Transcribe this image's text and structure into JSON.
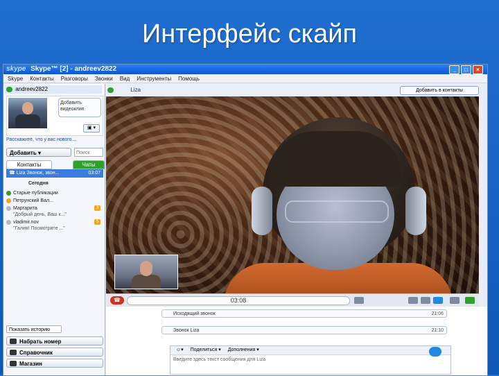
{
  "slide": {
    "title": "Интерфейс скайп"
  },
  "window": {
    "logo": "skype",
    "title": "Skype™ [2] - andreev2822",
    "min": "_",
    "max": "□",
    "close": "×"
  },
  "menu": [
    "Skype",
    "Контакты",
    "Разговоры",
    "Звонки",
    "Вид",
    "Инструменты",
    "Помощь"
  ],
  "left": {
    "username": "andreev2822",
    "profile_bubble": "Добавить видеоклип",
    "video_btn": "▣ ▾",
    "mood": "Расскажите, что у вас нового...",
    "add_button": "Добавить ▾",
    "search_placeholder": "Поиск",
    "tab_contacts": "Контакты",
    "tab_other": "Чаты",
    "selected_contact": {
      "name": "Liza",
      "sub": "Звонок, звон...",
      "time": "03:07"
    },
    "today_label": "Сегодня",
    "recent": [
      {
        "name": "Старые публикации",
        "sub": "",
        "count": "",
        "color": "#2ea12b"
      },
      {
        "name": "Петрунский Вал...",
        "sub": "",
        "count": "",
        "color": "#f2a51d"
      },
      {
        "name": "Маргарита",
        "sub": "\"Добрый день, Ваш к...\"",
        "count": "3",
        "color": "#b0b8c8"
      },
      {
        "name": "vladimir.nov",
        "sub": "\"Галия! Посмотрите ...\"",
        "count": "5",
        "color": "#b0b8c8"
      }
    ],
    "history_button": "Показать историю",
    "nav": [
      "Набрать номер",
      "Справочник",
      "Магазин"
    ]
  },
  "chat": {
    "contact_name": "Liza",
    "add_contact": "Добавить в контакты",
    "timer": "03:08",
    "messages": [
      {
        "text": "Исходящий звонок",
        "time": "21:06"
      },
      {
        "text": "Звонок Liza",
        "time": "21:10"
      }
    ],
    "composer": {
      "share": "Поделиться ▾",
      "extras": "Дополнения ▾",
      "placeholder": "Введите здесь текст сообщения для Liza"
    }
  }
}
